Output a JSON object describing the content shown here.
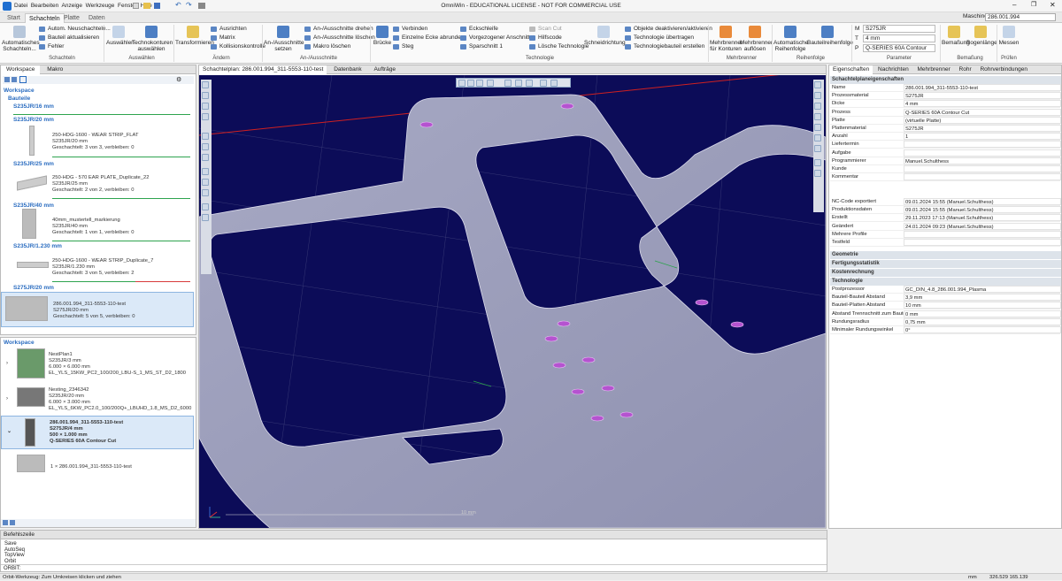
{
  "app": {
    "title": "OmniWin - EDUCATIONAL LICENSE - NOT FOR COMMERCIAL USE",
    "menus": [
      "Datei",
      "Bearbeiten",
      "Anzeige",
      "Werkzeuge",
      "Fenster",
      "Hilfe"
    ],
    "machine_label": "Maschine:",
    "machine_value": "286.001.994"
  },
  "ribbon": {
    "tabs": [
      "Start",
      "Schachteln",
      "Platte",
      "Daten"
    ],
    "schachteln": {
      "auto_btn": "Automatisches Schachteln...",
      "auto_neu": "Autom. Neuschachteln...",
      "bauteil_akt": "Bauteil aktualisieren",
      "fehler": "Fehler",
      "group": "Schachteln"
    },
    "auswaehlen": {
      "ausw": "Auswählen",
      "tech": "Technokonturen auswählen",
      "group": "Auswählen"
    },
    "aendern": {
      "transf": "Transformieren",
      "ausrichten": "Ausrichten",
      "matrix": "Matrix",
      "koll": "Kollisionskontrolle",
      "group": "Ändern"
    },
    "anaus": {
      "big": "An-/Ausschnitte setzen",
      "drehen": "An-/Ausschnitte drehen",
      "loeschen": "An-/Ausschnitte löschen",
      "makro": "Makro löschen",
      "group": "An-/Ausschnitte"
    },
    "tech": {
      "bruecke": "Brücke",
      "verbinden": "Verbinden",
      "ecke": "Einzelne Ecke abrunden",
      "steg": "Steg",
      "eckschl": "Eckschleife",
      "vorgez": "Vorgezogener Anschnitt",
      "sparschn": "Sparschnitt 1",
      "scan": "Scan Cut",
      "hilfscode": "Hilfscode",
      "loesche": "Lösche Technologie",
      "schneidr": "Schneidrichtung",
      "objekte": "Objekte deaktivieren/aktivieren",
      "techuebr": "Technologie übertragen",
      "techbau": "Technologiebauteil erstellen",
      "group": "Technologie"
    },
    "mehrbr": {
      "mfk": "Mehrbrenner für Konturen",
      "maufl": "Mehrbrenner auflösen",
      "group": "Mehrbrenner"
    },
    "reihenf": {
      "auto": "Automatische Reihenfolge",
      "bauteil": "Bauteilreihenfolge",
      "group": "Reihenfolge"
    },
    "param": {
      "m": "S275JR",
      "t": "4 mm",
      "p": "Q-SERIES 60A Contour Cut",
      "group": "Parameter"
    },
    "bemass": {
      "bem": "Bemaßung",
      "bogen": "Bogenlänge",
      "group": "Bemaßung"
    },
    "pruefen": {
      "messen": "Messen",
      "group": "Prüfen"
    }
  },
  "left": {
    "tabs": [
      "Workspace",
      "Makro"
    ],
    "sec_workspace": "Workspace",
    "sec_bauteile": "Bauteile",
    "groups": [
      {
        "label": "S235JR/16 mm",
        "items": []
      },
      {
        "label": "S235JR/20 mm",
        "items": [
          {
            "name": "250-HDG-1600 - WEAR STRIP_FLAT",
            "mat": "S235JR/20 mm",
            "status": "Geschachtelt: 3 von 3, verbleiben: 0"
          }
        ]
      },
      {
        "label": "S235JR/25 mm",
        "items": [
          {
            "name": "250-HDG - 570 EAR PLATE_Duplicate_22",
            "mat": "S235JR/25 mm",
            "status": "Geschachtelt: 2 von 2, verbleiben: 0"
          }
        ]
      },
      {
        "label": "S235JR/40 mm",
        "items": [
          {
            "name": "40mm_mustertell_markierung",
            "mat": "S235JR/40 mm",
            "status": "Geschachtelt: 1 von 1, verbleiben: 0"
          }
        ]
      },
      {
        "label": "S235JR/1.230 mm",
        "items": [
          {
            "name": "250-HDG-1600 - WEAR STRIP_Duplicate_7",
            "mat": "S235JR/1.230 mm",
            "status": "Geschachtelt: 3 von 5, verbleiben: 2"
          }
        ]
      },
      {
        "label": "S275JR/20 mm",
        "items": [
          {
            "name": "286.001.994_311-5553-110-test",
            "mat": "S275JR/20 mm",
            "status": "Geschachtelt: 5 von 5, verbleiben: 0"
          }
        ]
      }
    ],
    "sec_workspace2": "Workspace",
    "plans": [
      {
        "name": "NestPlan1",
        "mat": "S235JR/3 mm",
        "dim": "6.000 × 6.000 mm",
        "file": "EL_YLS_15KW_PC2_100/200_LBU-S_1_MS_ST_D2_1800"
      },
      {
        "name": "Nesting_2346342",
        "mat": "S235JR/20 mm",
        "dim": "6.000 × 3.000 mm",
        "file": "EL_YLS_6KW_PC2.0_100/200Q+_LBUHD_1.8_MS_D2_6000"
      },
      {
        "name": "286.001.994_311-5553-110-test",
        "mat": "S275JR/4 mm",
        "dim": "500 × 1.000 mm",
        "file": "Q-SERIES 60A Contour Cut"
      }
    ],
    "sub": "1 × 286.001.994_311-5553-110-test"
  },
  "center": {
    "tabs": [
      "Schachtelplan: 286.001.994_311-5553-110-test",
      "Datenbank",
      "Aufträge"
    ],
    "scale": "10 mm"
  },
  "right": {
    "tabs": [
      "Eigenschaften",
      "Nachrichten",
      "Mehrbrenner",
      "Rohr",
      "Rohrverbindungen"
    ],
    "head1": "Schachtelplaneigenschaften",
    "props": [
      [
        "Name",
        "286.001.994_311-5553-110-test"
      ],
      [
        "Prozessmaterial",
        "S275JR"
      ],
      [
        "Dicke",
        "4 mm"
      ],
      [
        "Prozess",
        "Q-SERIES 60A Contour Cut"
      ],
      [
        "Platte",
        "(virtuelle Platte)"
      ],
      [
        "Plattenmaterial",
        "S275JR"
      ],
      [
        "Anzahl",
        "1"
      ],
      [
        "Liefertermin",
        ""
      ],
      [
        "Aufgabe",
        ""
      ],
      [
        "Programmierer",
        "Manuel.Schulthess"
      ],
      [
        "Kunde",
        ""
      ],
      [
        "Kommentar",
        ""
      ]
    ],
    "props2": [
      [
        "NC-Code exportiert",
        "09.01.2024 15:55 (Manuel.Schulthess)"
      ],
      [
        "Produktionsdaten",
        "09.01.2024 15:55 (Manuel.Schulthess)"
      ],
      [
        "Erstellt",
        "29.11.2023 17:13 (Manuel.Schulthess)"
      ],
      [
        "Geändert",
        "24.01.2024 09:23 (Manuel.Schulthess)"
      ],
      [
        "Mehrere Profile",
        ""
      ],
      [
        "Testfeld",
        ""
      ]
    ],
    "heads": [
      "Geometrie",
      "Fertigungsstatistik",
      "Kostenrechnung",
      "Technologie"
    ],
    "tech": [
      [
        "Postprozessor",
        "GC_DIN_4.8_286.001.994_Plasma"
      ],
      [
        "Bauteil-Bauteil Abstand",
        "3,9 mm"
      ],
      [
        "Bauteil-Platten Abstand",
        "10 mm"
      ],
      [
        "Abstand Trennschnitt zum Bauteil",
        "0 mm"
      ],
      [
        "Rundungsradius",
        "0,75 mm"
      ],
      [
        "Minimaler Rundungswinkel",
        "0°"
      ]
    ]
  },
  "cmd": {
    "title": "Befehlszeile",
    "lines": [
      "Save",
      "AutoSeq",
      "TopView",
      "Orbit"
    ],
    "prompt": "ORBIT:"
  },
  "status": {
    "text": "Orbit-Werkzeug: Zum Umkreisen klicken und ziehen",
    "unit": "mm",
    "coords": "326.529  165.139"
  }
}
